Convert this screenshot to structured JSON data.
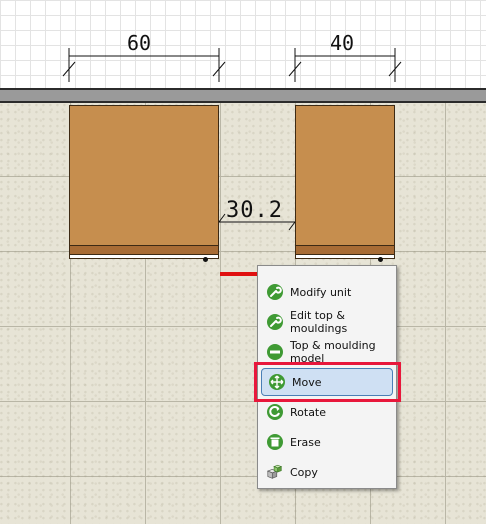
{
  "dimensions": {
    "left_width": "60",
    "right_width": "40",
    "gap": "30.2"
  },
  "menu": {
    "items": [
      {
        "label": "Modify unit",
        "icon": "wrench-icon"
      },
      {
        "label": "Edit top & mouldings",
        "icon": "wrench-icon"
      },
      {
        "label": "Top & moulding model",
        "icon": "minus-circle-icon"
      },
      {
        "label": "Move",
        "icon": "move-arrows-icon",
        "selected": true
      },
      {
        "label": "Rotate",
        "icon": "rotate-icon"
      },
      {
        "label": "Erase",
        "icon": "trash-icon"
      },
      {
        "label": "Copy",
        "icon": "copy-cubes-icon"
      }
    ]
  },
  "colors": {
    "cabinet": "#c68e4e",
    "highlight": "#e8173b",
    "menu_icon_green": "#3f9a34",
    "selection_fill": "#cfe0f3"
  }
}
